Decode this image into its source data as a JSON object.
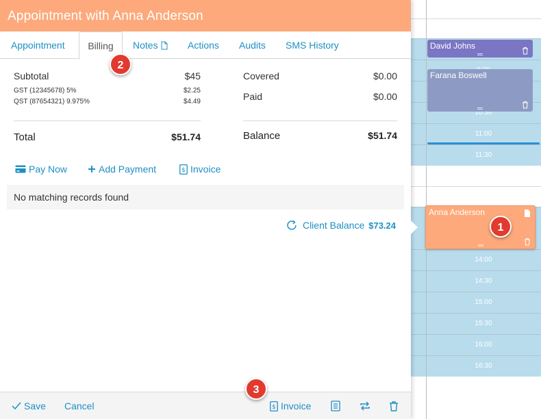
{
  "modal": {
    "title": "Appointment with Anna Anderson",
    "tabs": [
      {
        "label": "Appointment"
      },
      {
        "label": "Billing"
      },
      {
        "label": "Notes"
      },
      {
        "label": "Actions"
      },
      {
        "label": "Audits"
      },
      {
        "label": "SMS History"
      }
    ],
    "active_tab": "Billing"
  },
  "billing": {
    "subtotal_label": "Subtotal",
    "subtotal_value": "$45",
    "tax1_label": "GST (12345678) 5%",
    "tax1_value": "$2.25",
    "tax2_label": "QST (87654321) 9.975%",
    "tax2_value": "$4.49",
    "total_label": "Total",
    "total_value": "$51.74",
    "covered_label": "Covered",
    "covered_value": "$0.00",
    "paid_label": "Paid",
    "paid_value": "$0.00",
    "balance_label": "Balance",
    "balance_value": "$51.74"
  },
  "actions": {
    "pay_now": "Pay Now",
    "add_payment": "Add Payment",
    "invoice": "Invoice"
  },
  "records": {
    "empty_text": "No matching records found"
  },
  "client_balance": {
    "label": "Client Balance",
    "value": "$73.24"
  },
  "footer": {
    "save": "Save",
    "cancel": "Cancel",
    "invoice": "Invoice"
  },
  "calendar": {
    "appointments": [
      {
        "name": "David Johns",
        "color": "#7a76c4"
      },
      {
        "name": "Farana Boswell",
        "color": "#8d9bc4"
      },
      {
        "name": "Anna Anderson",
        "color": "#fda97c"
      }
    ],
    "times": [
      "9:30",
      "10:30",
      "11:00",
      "11:30",
      "14:00",
      "14:30",
      "15:00",
      "15:30",
      "16:00",
      "16:30"
    ]
  },
  "badges": [
    "1",
    "2",
    "3"
  ],
  "colors": {
    "header": "#fda97c",
    "link": "#1d8fc4",
    "badge": "#e23a2e",
    "calendar_slot": "#b9dcec"
  }
}
